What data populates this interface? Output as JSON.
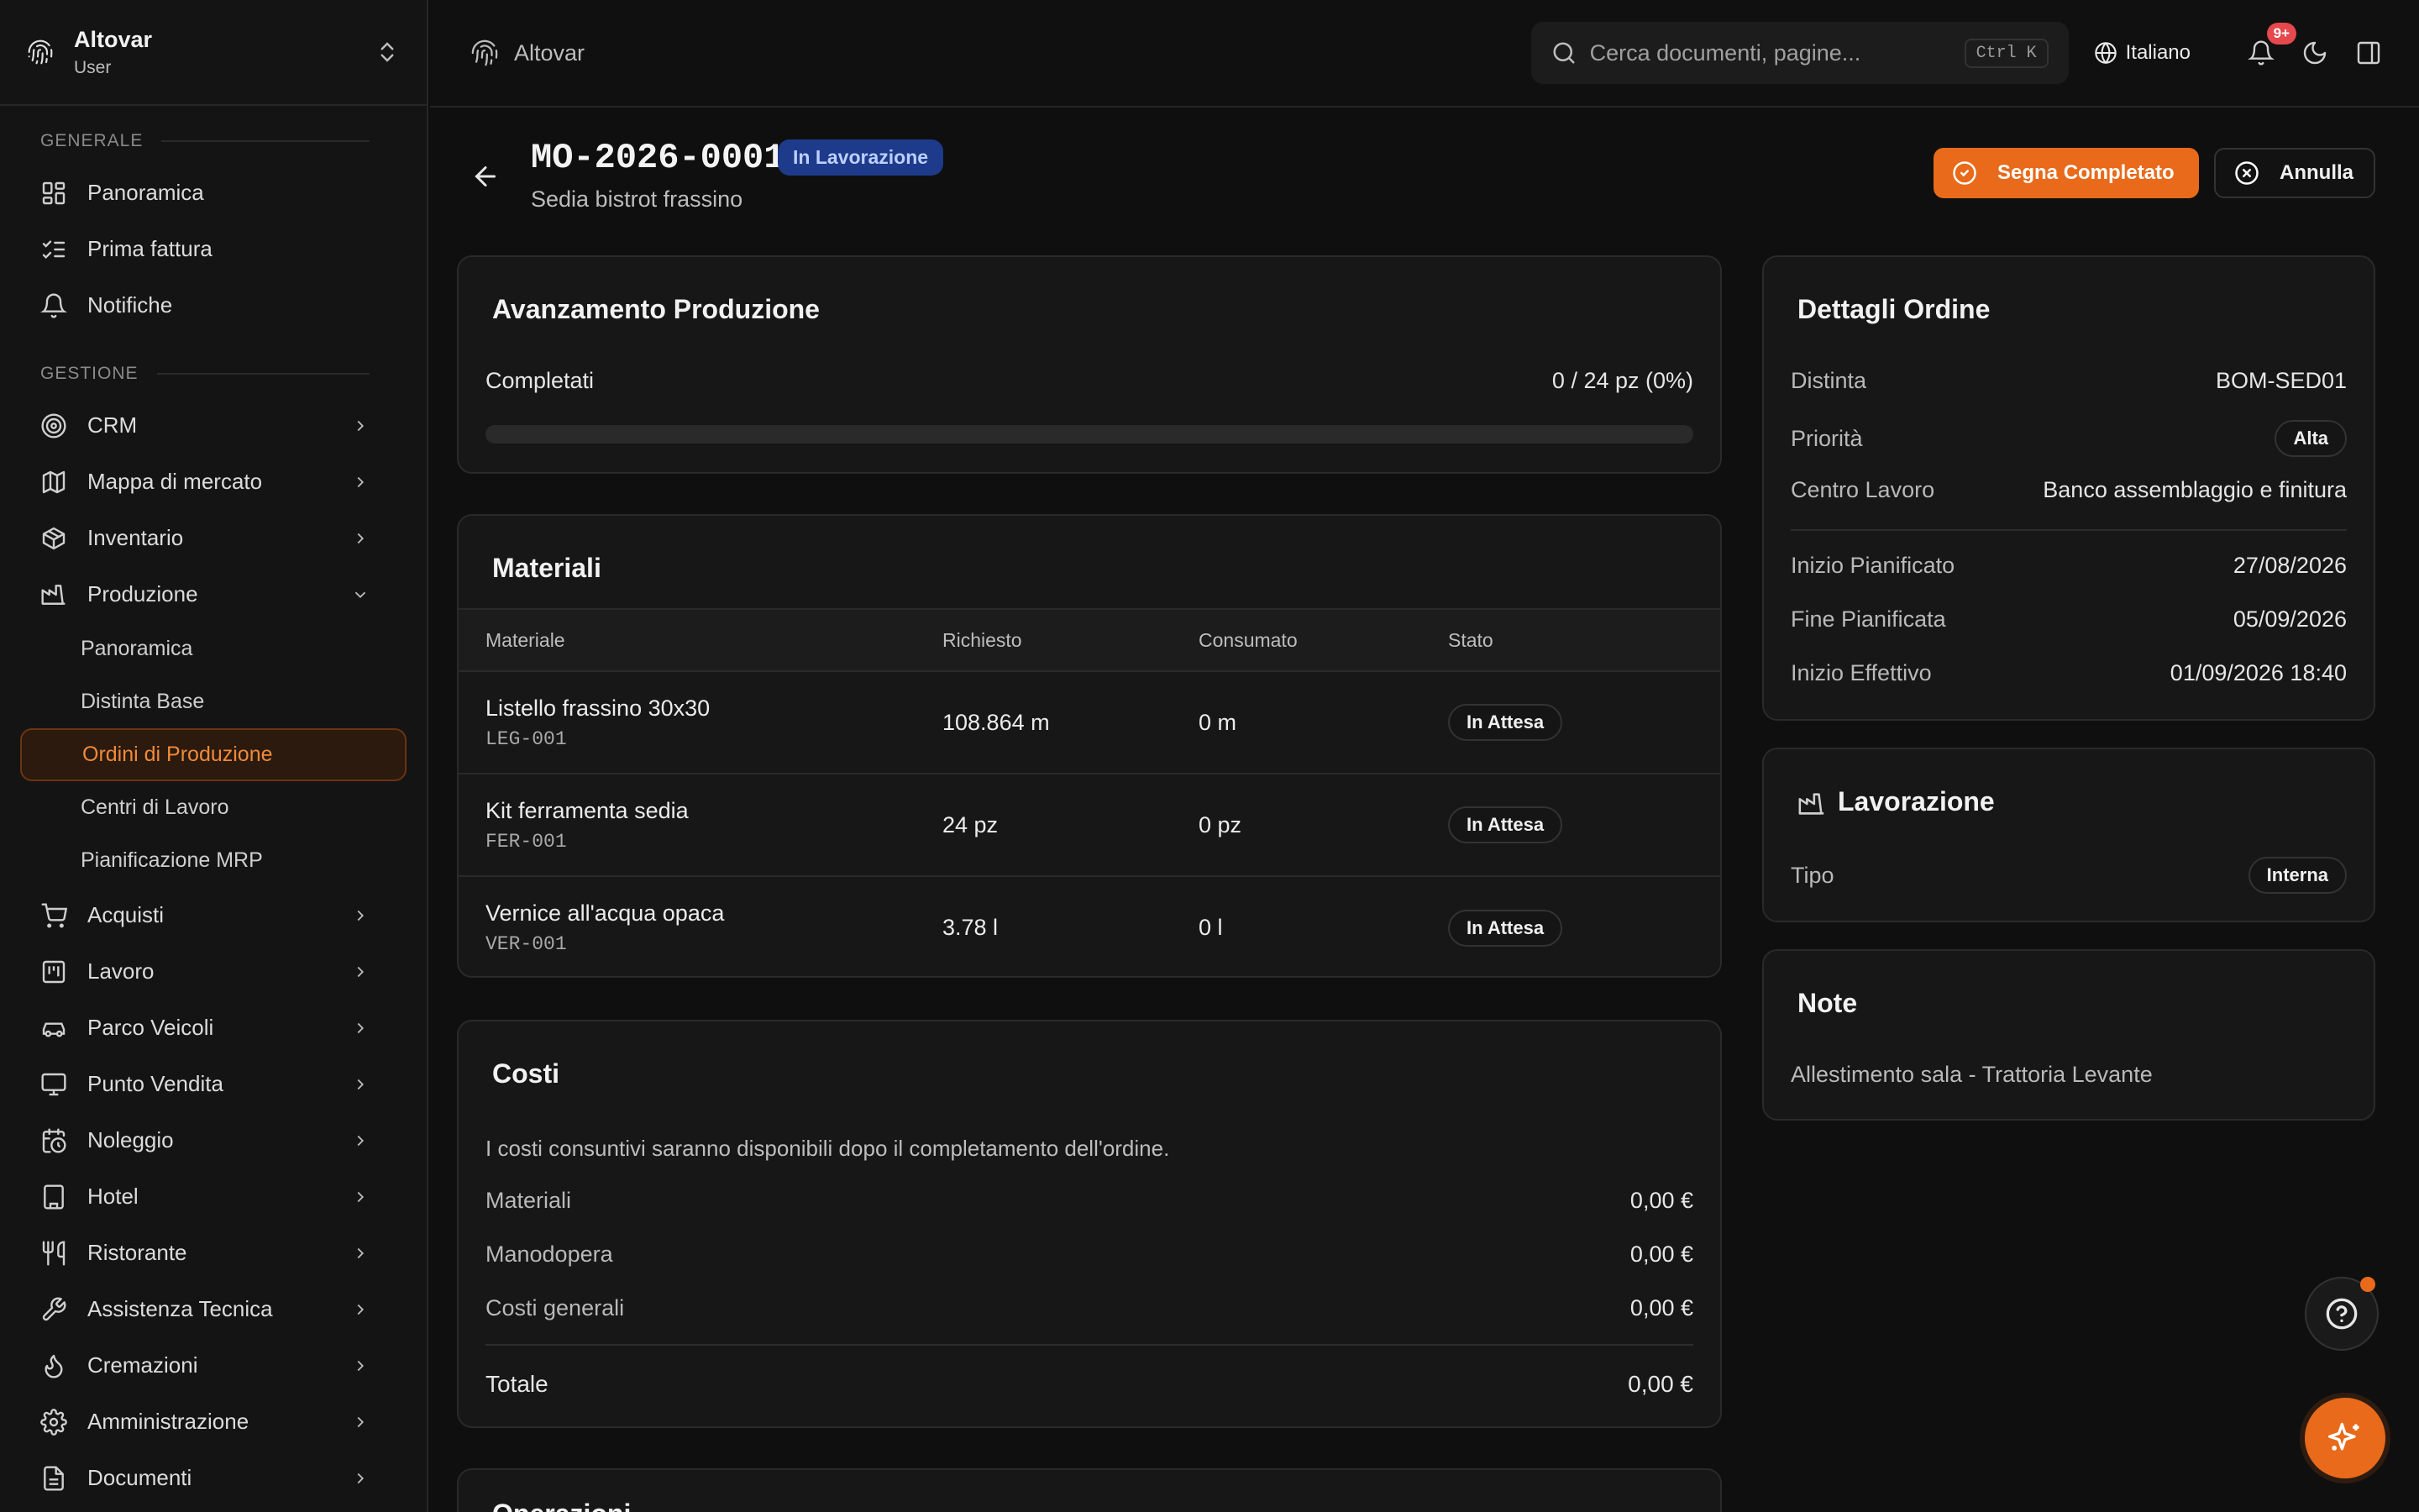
{
  "workspace": {
    "name": "Altovar",
    "role": "User"
  },
  "sidebar": {
    "sections": [
      {
        "label": "GENERALE",
        "items": [
          {
            "label": "Panoramica",
            "icon": "dashboard-icon"
          },
          {
            "label": "Prima fattura",
            "icon": "checklist-icon"
          },
          {
            "label": "Notifiche",
            "icon": "bell-icon"
          }
        ]
      },
      {
        "label": "GESTIONE",
        "items": [
          {
            "label": "CRM",
            "icon": "target-icon"
          },
          {
            "label": "Mappa di mercato",
            "icon": "map-icon"
          },
          {
            "label": "Inventario",
            "icon": "box-icon"
          },
          {
            "label": "Produzione",
            "icon": "factory-icon",
            "expanded": true
          },
          {
            "label": "Acquisti",
            "icon": "cart-icon"
          },
          {
            "label": "Lavoro",
            "icon": "kanban-icon"
          },
          {
            "label": "Parco Veicoli",
            "icon": "car-icon"
          },
          {
            "label": "Punto Vendita",
            "icon": "monitor-icon"
          },
          {
            "label": "Noleggio",
            "icon": "calendar-clock-icon"
          },
          {
            "label": "Hotel",
            "icon": "building-icon"
          },
          {
            "label": "Ristorante",
            "icon": "utensils-icon"
          },
          {
            "label": "Assistenza Tecnica",
            "icon": "wrench-icon"
          },
          {
            "label": "Cremazioni",
            "icon": "flame-icon"
          },
          {
            "label": "Amministrazione",
            "icon": "gear-icon"
          },
          {
            "label": "Documenti",
            "icon": "file-icon"
          }
        ]
      }
    ],
    "produzione_sub": [
      "Panoramica",
      "Distinta Base",
      "Ordini di Produzione",
      "Centri di Lavoro",
      "Pianificazione MRP"
    ],
    "active_sub": "Ordini di Produzione"
  },
  "topbar": {
    "breadcrumb": "Altovar",
    "search_placeholder": "Cerca documenti, pagine...",
    "search_shortcut": "Ctrl K",
    "language": "Italiano",
    "notification_badge": "9+"
  },
  "order": {
    "code": "MO-2026-0001",
    "status": "In Lavorazione",
    "product": "Sedia bistrot frassino",
    "complete_button": "Segna Completato",
    "cancel_button": "Annulla"
  },
  "progress": {
    "title": "Avanzamento Produzione",
    "label": "Completati",
    "value": "0 / 24 pz (0%)",
    "fraction": 0
  },
  "materials": {
    "title": "Materiali",
    "columns": [
      "Materiale",
      "Richiesto",
      "Consumato",
      "Stato"
    ],
    "rows": [
      {
        "name": "Listello frassino 30x30",
        "code": "LEG-001",
        "required": "108.864 m",
        "consumed": "0 m",
        "status": "In Attesa"
      },
      {
        "name": "Kit ferramenta sedia",
        "code": "FER-001",
        "required": "24 pz",
        "consumed": "0 pz",
        "status": "In Attesa"
      },
      {
        "name": "Vernice all'acqua opaca",
        "code": "VER-001",
        "required": "3.78 l",
        "consumed": "0 l",
        "status": "In Attesa"
      }
    ]
  },
  "costs": {
    "title": "Costi",
    "note": "I costi consuntivi saranno disponibili dopo il completamento dell'ordine.",
    "lines": [
      {
        "label": "Materiali",
        "value": "0,00 €"
      },
      {
        "label": "Manodopera",
        "value": "0,00 €"
      },
      {
        "label": "Costi generali",
        "value": "0,00 €"
      }
    ],
    "total_label": "Totale",
    "total_value": "0,00 €"
  },
  "operations": {
    "title": "Operazioni"
  },
  "details": {
    "title": "Dettagli Ordine",
    "bom_label": "Distinta",
    "bom_value": "BOM-SED01",
    "priority_label": "Priorità",
    "priority_value": "Alta",
    "workcenter_label": "Centro Lavoro",
    "workcenter_value": "Banco assemblaggio e finitura",
    "planned_start_label": "Inizio Pianificato",
    "planned_start_value": "27/08/2026",
    "planned_end_label": "Fine Pianificata",
    "planned_end_value": "05/09/2026",
    "actual_start_label": "Inizio Effettivo",
    "actual_start_value": "01/09/2026 18:40"
  },
  "processing": {
    "title": "Lavorazione",
    "type_label": "Tipo",
    "type_value": "Interna"
  },
  "notes": {
    "title": "Note",
    "text": "Allestimento sala - Trattoria Levante"
  },
  "colors": {
    "accent": "#e86a1a",
    "status_blue": "#1e3a8a"
  }
}
